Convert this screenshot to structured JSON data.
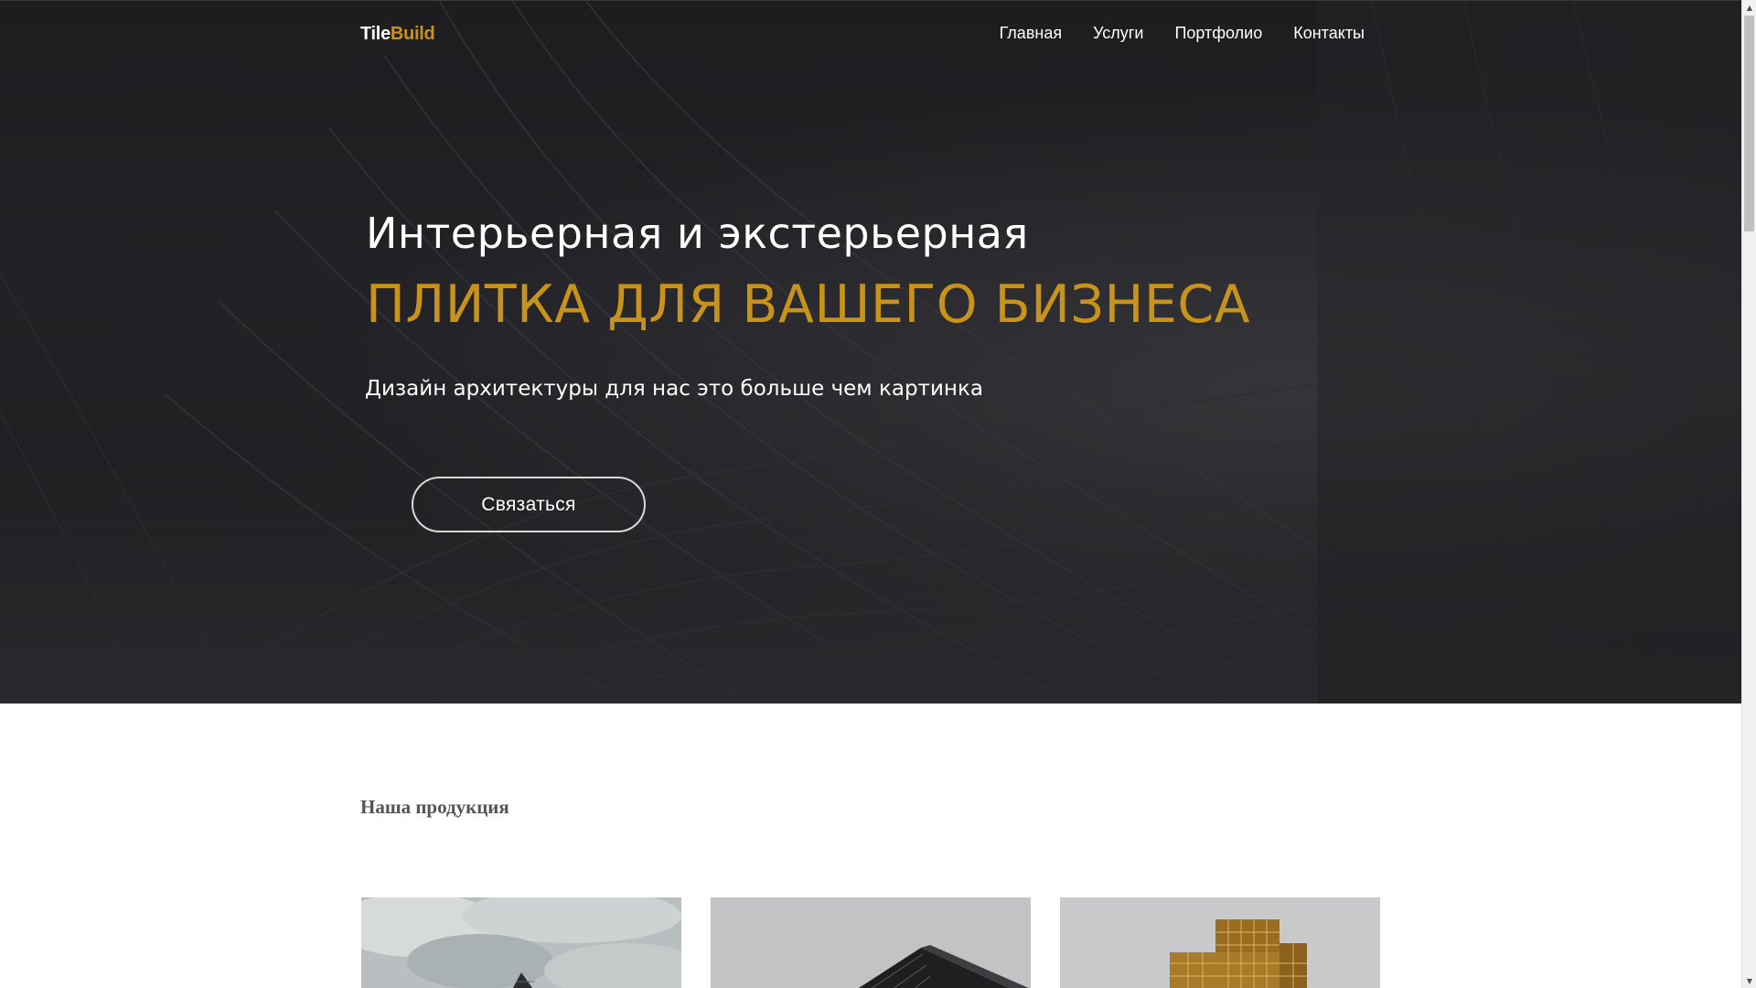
{
  "header": {
    "logo_part1": "Tile",
    "logo_part2": "Build",
    "nav": [
      {
        "label": "Главная"
      },
      {
        "label": "Услуги"
      },
      {
        "label": "Портфолио"
      },
      {
        "label": "Контакты"
      }
    ]
  },
  "hero": {
    "title_line1": "Интерьерная и экстерьерная",
    "title_line2": "ПЛИТКА ДЛЯ ВАШЕГО БИЗНЕСА",
    "subtitle": "Дизайн архитектуры для нас это больше чем картинка",
    "cta_label": "Связаться"
  },
  "products": {
    "title": "Наша продукция",
    "cards": [
      {
        "image": "building-cloudy-sky"
      },
      {
        "image": "glass-building-corner"
      },
      {
        "image": "golden-facade-building"
      }
    ]
  },
  "colors": {
    "accent": "#c8931a",
    "hero_bg": "#1e1e21",
    "text_light": "#ffffff",
    "section_title": "#555555"
  }
}
